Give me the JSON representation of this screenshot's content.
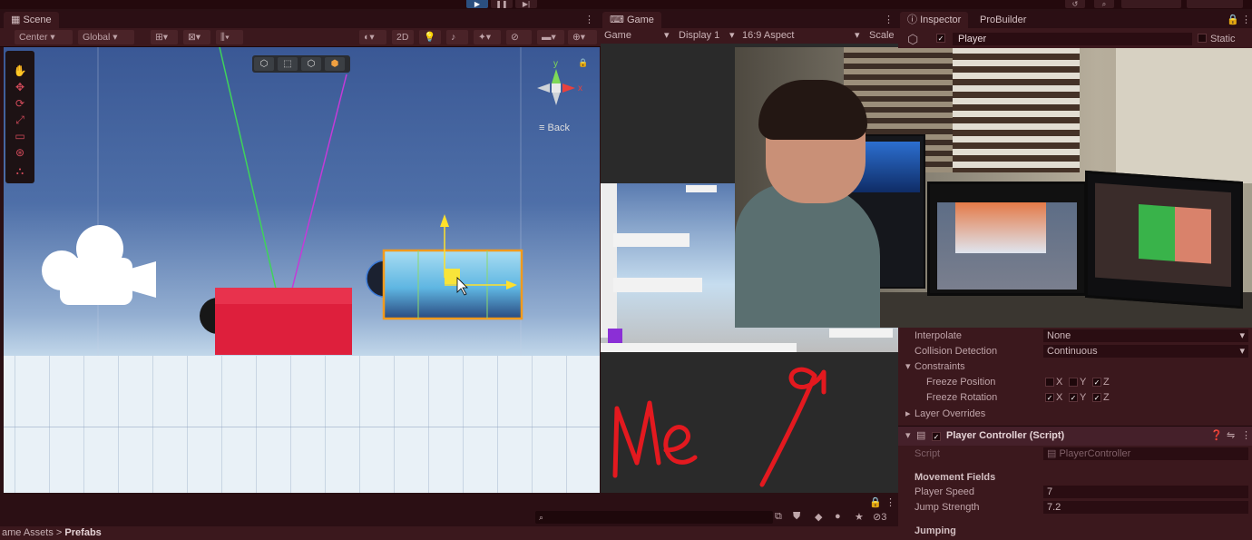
{
  "scene": {
    "tab": "Scene",
    "toolbar": {
      "pivot": "Center",
      "space": "Global",
      "mode_2d": "2D"
    },
    "gizmo": {
      "axis_x": "x",
      "axis_y": "y",
      "back": "Back"
    }
  },
  "game": {
    "tab": "Game",
    "toolbar": {
      "view": "Game",
      "display": "Display 1",
      "aspect": "16:9 Aspect",
      "scale": "Scale"
    },
    "annotation": "Me"
  },
  "inspector": {
    "tabs": [
      "Inspector",
      "ProBuilder"
    ],
    "object_name": "Player",
    "static_label": "Static",
    "rigidbody": {
      "interpolate_label": "Interpolate",
      "interpolate_value": "None",
      "collision_label": "Collision Detection",
      "collision_value": "Continuous",
      "constraints_label": "Constraints",
      "freeze_position_label": "Freeze Position",
      "freeze_rotation_label": "Freeze Rotation",
      "axes": [
        "X",
        "Y",
        "Z"
      ],
      "freeze_position": [
        false,
        false,
        true
      ],
      "freeze_rotation": [
        true,
        true,
        true
      ],
      "layer_overrides_label": "Layer Overrides"
    },
    "component": {
      "title": "Player Controller (Script)",
      "script_label": "Script",
      "script_value": "PlayerController",
      "section_movement": "Movement Fields",
      "speed_label": "Player Speed",
      "speed_value": "7",
      "jump_label": "Jump Strength",
      "jump_value": "7.2",
      "section_jumping": "Jumping"
    }
  },
  "bottom": {
    "breadcrumb_root": "ame Assets",
    "breadcrumb_sep": ">",
    "breadcrumb_current": "Prefabs",
    "hidden_count": "3"
  },
  "colors": {
    "accent_orange": "#f29a1c",
    "annotation_red": "#e3191f",
    "player_red": "#e0213f",
    "theme_bg": "#3b181d"
  }
}
